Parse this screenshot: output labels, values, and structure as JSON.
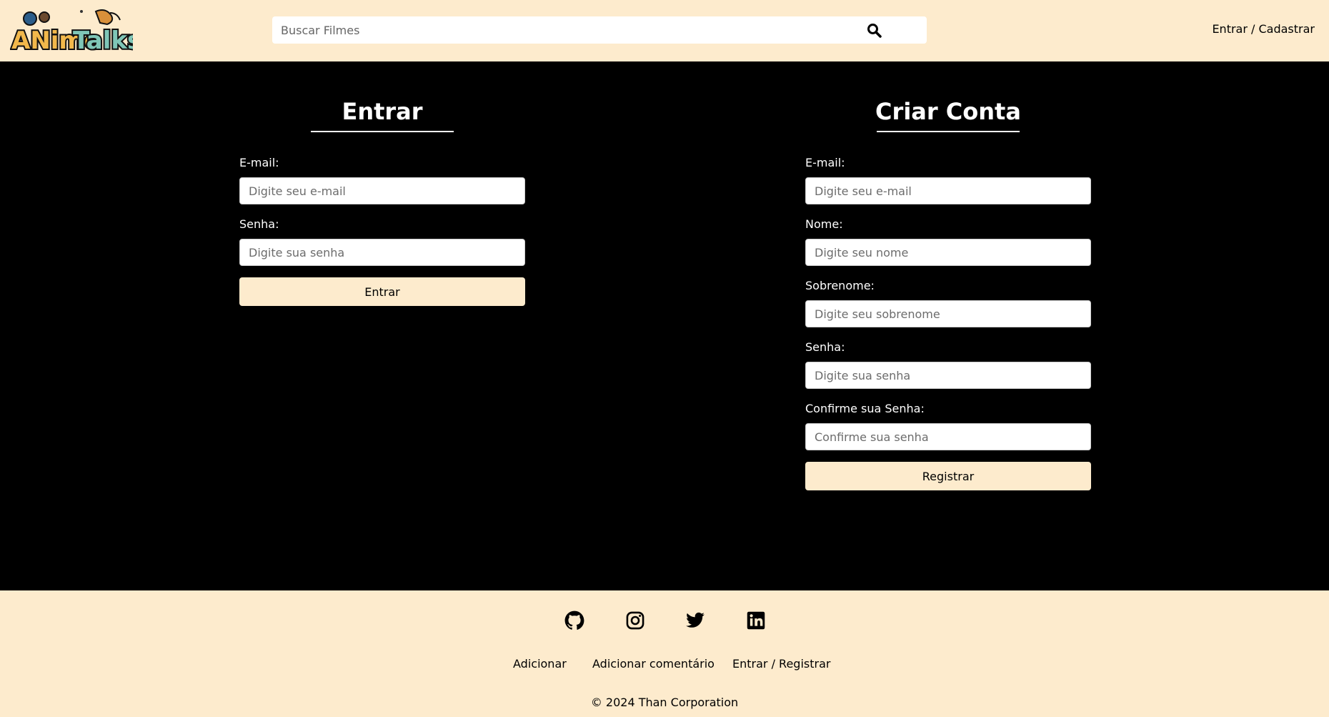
{
  "header": {
    "logo_text": "AnimeTalks",
    "search_placeholder": "Buscar Filmes",
    "auth_link": "Entrar / Cadastrar"
  },
  "login": {
    "title": "Entrar",
    "email_label": "E-mail:",
    "email_placeholder": "Digite seu e-mail",
    "password_label": "Senha:",
    "password_placeholder": "Digite sua senha",
    "submit_label": "Entrar"
  },
  "register": {
    "title": "Criar Conta",
    "email_label": "E-mail:",
    "email_placeholder": "Digite seu e-mail",
    "name_label": "Nome:",
    "name_placeholder": "Digite seu nome",
    "surname_label": "Sobrenome:",
    "surname_placeholder": "Digite seu sobrenome",
    "password_label": "Senha:",
    "password_placeholder": "Digite sua senha",
    "confirm_label": "Confirme sua Senha:",
    "confirm_placeholder": "Confirme sua senha",
    "submit_label": "Registrar"
  },
  "footer": {
    "social_icons": [
      "github-icon",
      "instagram-icon",
      "twitter-icon",
      "linkedin-icon"
    ],
    "links": [
      "Adicionar",
      "Adicionar comentário",
      "Entrar / Registrar"
    ],
    "copyright": "© 2024 Than Corporation"
  },
  "colors": {
    "cream": "#fdebcd",
    "background": "#000000",
    "text_light": "#ffffff"
  }
}
